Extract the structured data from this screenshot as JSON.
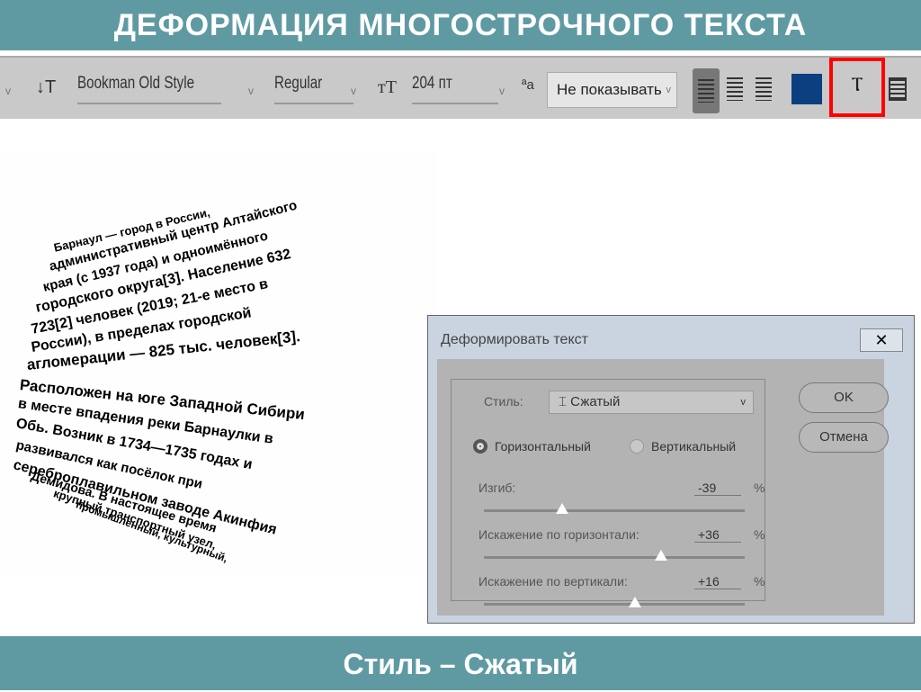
{
  "header": {
    "title": "ДЕФОРМАЦИЯ  МНОГОСТРОЧНОГО ТЕКСТА"
  },
  "footer": {
    "caption": "Стиль – Сжатый"
  },
  "toolbar": {
    "font_family": "Bookman Old Style",
    "font_style": "Regular",
    "font_size": "204 пт",
    "antialias": "Не показывать",
    "color": "#0b3f80"
  },
  "text_block": {
    "paragraph1": [
      "Барнаул — город в России,",
      "административный центр Алтайского",
      "края (с 1937 года) и одноимённого",
      "городского округа[3]. Население 632",
      "723[2] человек (2019; 21-е место в",
      "России), в пределах городской",
      "агломерации — 825 тыс. человек[3]."
    ],
    "paragraph2": [
      "Расположен на юге Западной Сибири",
      "в месте впадения реки Барнаулки в",
      "Обь. Возник в 1734—1735 годах и",
      "развивался как посёлок при",
      "сереброплавильном заводе Акинфия",
      "Демидова. В настоящее время",
      "крупный транспортный узел,",
      "промышленный, культурный,"
    ]
  },
  "dialog": {
    "title": "Деформировать текст",
    "close": "✕",
    "style_label": "Стиль:",
    "style_value": "Сжатый",
    "orientation": {
      "horizontal": "Горизонтальный",
      "vertical": "Вертикальный",
      "selected": "horizontal"
    },
    "bend": {
      "label": "Изгиб:",
      "value": "-39",
      "unit": "%"
    },
    "hdist": {
      "label": "Искажение по горизонтали:",
      "value": "+36",
      "unit": "%"
    },
    "vdist": {
      "label": "Искажение по вертикали:",
      "value": "+16",
      "unit": "%"
    },
    "ok": "OK",
    "cancel": "Отмена"
  }
}
